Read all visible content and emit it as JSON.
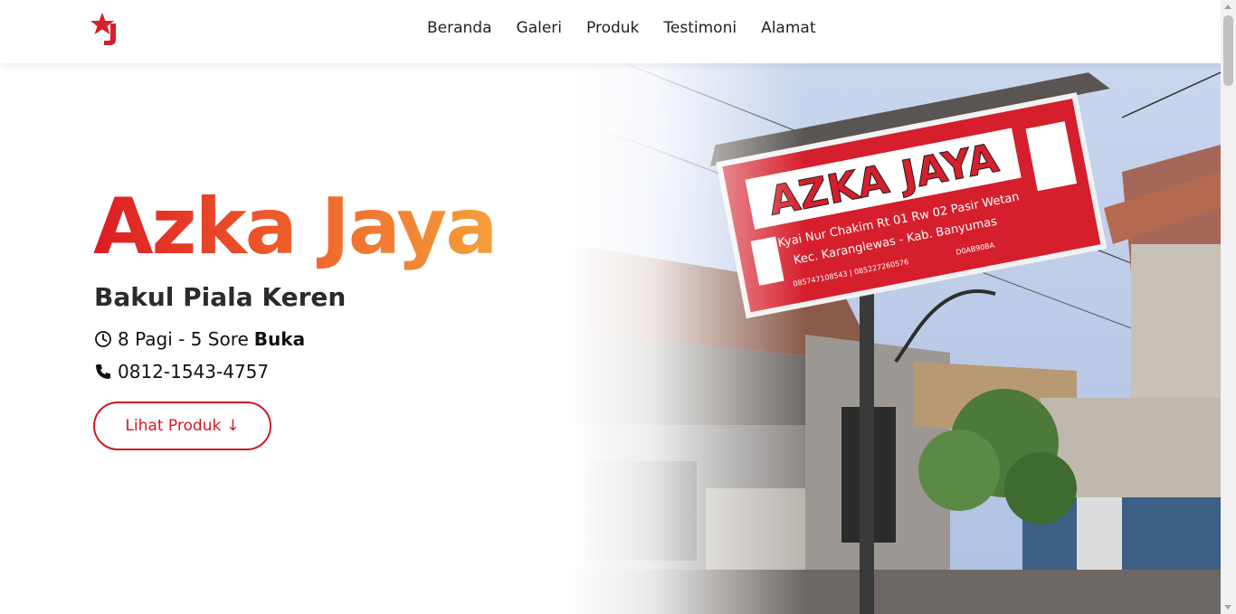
{
  "header": {
    "logo_icon": "star-j-logo",
    "nav": [
      {
        "label": "Beranda"
      },
      {
        "label": "Galeri"
      },
      {
        "label": "Produk"
      },
      {
        "label": "Testimoni"
      },
      {
        "label": "Alamat"
      }
    ]
  },
  "hero": {
    "title": "Azka Jaya",
    "subtitle": "Bakul Piala Keren",
    "hours_text": "8 Pagi - 5 Sore",
    "hours_status": "Buka",
    "phone": "0812-1543-4757",
    "cta_label": "Lihat Produk",
    "cta_icon": "arrow-down-icon"
  },
  "photo_sign": {
    "name": "AZKA JAYA",
    "address_line1": "Jl. Kyai Nur Chakim Rt 01 Rw 02 Pasir Wetan",
    "address_line2": "Kec. Karanglewas - Kab. Banyumas",
    "phones": "085747108543 | 085227260576",
    "code": "D0AB90BA"
  },
  "colors": {
    "brand_red": "#cf1a24",
    "gradient_start": "#dc1c24",
    "gradient_end": "#f5a03a"
  }
}
